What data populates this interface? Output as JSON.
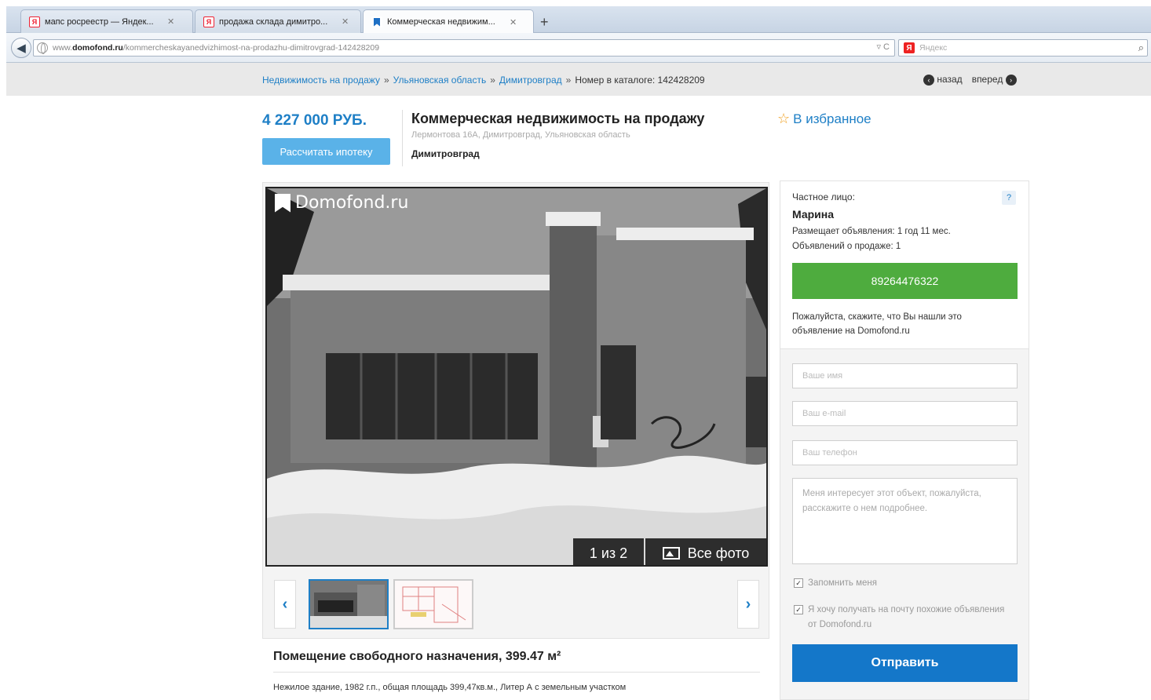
{
  "browser": {
    "tabs": [
      {
        "label": "мапс росреестр — Яндек...",
        "icon": "yandex-icon"
      },
      {
        "label": "продажа склада димитро...",
        "icon": "yandex-icon"
      },
      {
        "label": "Коммерческая недвижим...",
        "icon": "domofond-icon"
      }
    ],
    "new_tab": "+",
    "url_pre": "www.",
    "url_host": "domofond.ru",
    "url_path": "/kommercheskayanedvizhimost-na-prodazhu-dimitrovgrad-142428209",
    "search_placeholder": "Яндекс"
  },
  "breadcrumb": {
    "items": [
      "Недвижимость на продажу",
      "Ульяновская область",
      "Димитровград"
    ],
    "separator": "»",
    "catalog_number": "Номер в каталоге: 142428209"
  },
  "pager": {
    "back": "назад",
    "forward": "вперед"
  },
  "listing": {
    "price": "4 227 000 РУБ.",
    "mortgage_label": "Рассчитать ипотеку",
    "title": "Коммерческая недвижимость на продажу",
    "address": "Лермонтова 16А, Димитровград, Ульяновская область",
    "city": "Димитровград",
    "favorite_label": "В избранное"
  },
  "gallery": {
    "watermark": "Domofond.ru",
    "counter": "1 из 2",
    "all_photos": "Все фото",
    "prev": "‹",
    "next": "›"
  },
  "description": {
    "title": "Помещение свободного назначения, 399.47 м²",
    "text": "Нежилое здание, 1982 г.п., общая площадь 399,47кв.м., Литер А с земельным участком"
  },
  "seller": {
    "type": "Частное лицо:",
    "help": "?",
    "name": "Марина",
    "posting_since": "Размещает объявления: 1 год 11 мес.",
    "listings_count": "Объявлений о продаже: 1",
    "phone": "89264476322",
    "note": "Пожалуйста, скажите, что Вы нашли это объявление на Domofond.ru"
  },
  "form": {
    "name_placeholder": "Ваше имя",
    "email_placeholder": "Ваш e-mail",
    "phone_placeholder": "Ваш телефон",
    "message": "Меня интересует этот объект, пожалуйста, расскажите о нем подробнее.",
    "remember_label": "Запомнить меня",
    "subscribe_label": "Я хочу получать на почту похожие объявления от Domofond.ru",
    "submit_label": "Отправить"
  },
  "colors": {
    "accent": "#1e7fc6",
    "phone_button": "#4eac3e",
    "submit_button": "#1477c9",
    "mortgage_button": "#5ab2e8"
  }
}
